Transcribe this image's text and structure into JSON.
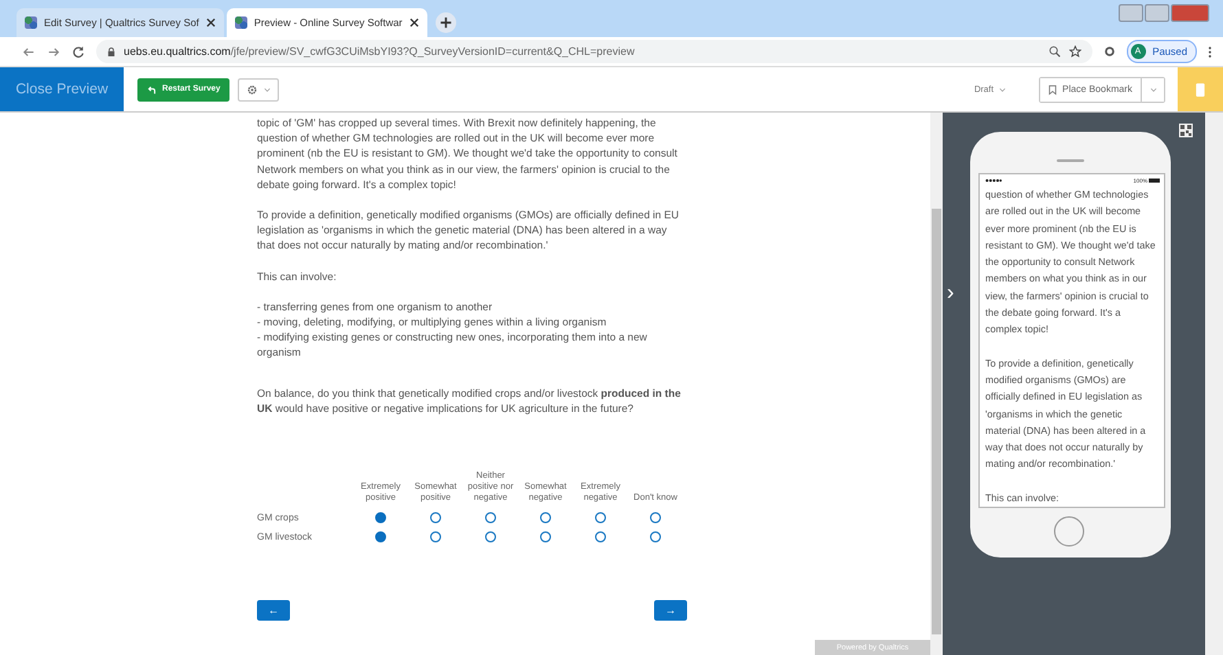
{
  "browser": {
    "tabs": [
      {
        "title": "Edit Survey | Qualtrics Survey Sof",
        "selected": false
      },
      {
        "title": "Preview - Online Survey Softwar",
        "selected": true
      }
    ],
    "url": {
      "host": "uebs.eu.qualtrics.com",
      "path": "/jfe/preview/SV_cwfG3CUiMsbYI93?Q_SurveyVersionID=current&Q_CHL=preview"
    },
    "profile": {
      "initial": "A",
      "label": "Paused"
    }
  },
  "toolbar": {
    "close": "Close Preview",
    "restart": "Restart Survey",
    "status": "Draft",
    "bookmark": "Place Bookmark"
  },
  "survey": {
    "paragraphs": [
      "topic of 'GM' has cropped up several times.  With Brexit now definitely happening, the question of whether GM technologies are rolled out in the UK will become ever more prominent (nb the EU is resistant to GM).  We thought we'd take the opportunity to consult Network members on what you think as in our view, the farmers' opinion is crucial to the debate going forward.  It's a complex topic!",
      "To provide a definition, genetically modified organisms (GMOs) are officially defined in EU legislation as 'organisms in which the genetic material (DNA) has been altered in a way that does not occur naturally by mating and/or recombination.'",
      "This can involve:",
      "- transferring genes from one organism to another\n- moving, deleting, modifying, or multiplying genes within a living organism\n- modifying existing genes or constructing new ones, incorporating them into a new organism"
    ],
    "question": "On balance, do you think that genetically modified crops and/or livestock **produced in the UK** would have positive or negative implications for UK agriculture in the future?",
    "columns": [
      "Extremely positive",
      "Somewhat positive",
      "Neither positive nor negative",
      "Somewhat negative",
      "Extremely negative",
      "Don't know"
    ],
    "rows": [
      {
        "label": "GM crops",
        "choices": [
          {
            "selected": true
          },
          {
            "selected": false
          },
          {
            "selected": false
          },
          {
            "selected": false
          },
          {
            "selected": false
          },
          {
            "selected": false
          }
        ]
      },
      {
        "label": "GM livestock",
        "choices": [
          {
            "selected": true
          },
          {
            "selected": false
          },
          {
            "selected": false
          },
          {
            "selected": false
          },
          {
            "selected": false
          },
          {
            "selected": false
          }
        ]
      }
    ],
    "back": "←",
    "next": "→",
    "powered": "Powered by Qualtrics"
  },
  "mobile": {
    "battery": "100%",
    "paragraphs": [
      "question of whether GM technologies are rolled out in the UK will become ever more prominent (nb the EU is resistant to GM).  We thought we'd take the opportunity to consult Network members on what you think as in our view, the farmers' opinion is crucial to the debate going forward.  It's a complex topic!",
      "To provide a definition, genetically modified organisms (GMOs) are officially defined in EU legislation as 'organisms in which the genetic material (DNA) has been altered in a way that does not occur naturally by mating and/or recombination.'",
      "This can involve:"
    ],
    "collapse": "›"
  }
}
